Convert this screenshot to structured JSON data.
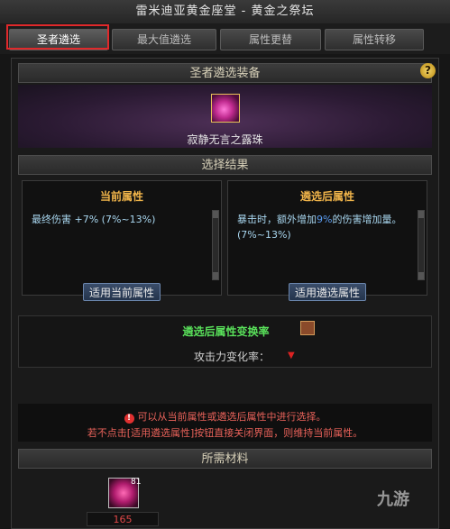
{
  "window": {
    "title": "雷米迪亚黄金座堂 - 黄金之祭坛"
  },
  "tabs": [
    {
      "label": "圣者遴选",
      "active": true
    },
    {
      "label": "最大值遴选",
      "active": false
    },
    {
      "label": "属性更替",
      "active": false
    },
    {
      "label": "属性转移",
      "active": false
    }
  ],
  "equipment": {
    "header": "圣者遴选装备",
    "item_name": "寂静无言之露珠",
    "help": "?"
  },
  "results": {
    "header": "选择结果",
    "current": {
      "title": "当前属性",
      "text": "最终伤害 +7% (7%~13%)",
      "button": "适用当前属性"
    },
    "selected": {
      "title": "遴选后属性",
      "text_before": "暴击时，额外增加",
      "text_pct": "9%",
      "text_after": "的伤害增加量。(7%~13%)",
      "button": "适用遴选属性"
    }
  },
  "rate": {
    "title": "遴选后属性变换率",
    "label": "攻击力变化率：",
    "arrow": "▼"
  },
  "notice": {
    "line1": "可以从当前属性或遴选后属性中进行选择。",
    "line2": "若不点击[适用遴选属性]按钮直接关闭界面，则维持当前属性。",
    "warn": "!"
  },
  "materials": {
    "header": "所需材料",
    "count": "81",
    "amount": "165"
  },
  "watermark": "九游",
  "colors": {
    "highlight": "#e0292b",
    "tip": "#e8625a",
    "rate": "#59e05a",
    "title_gold": "#f0b44a"
  }
}
